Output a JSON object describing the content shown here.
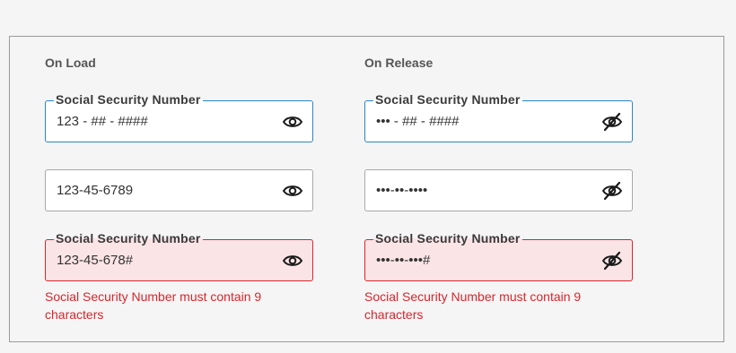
{
  "on_load": {
    "title": "On Load",
    "focused_field": {
      "label": "Social Security Number",
      "value": "123 - ## - ####",
      "icon": "eye-icon"
    },
    "filled_field": {
      "value": "123-45-6789",
      "icon": "eye-icon"
    },
    "error_field": {
      "label": "Social Security Number",
      "value": "123-45-678#",
      "icon": "eye-icon"
    },
    "error_message": "Social Security Number must contain 9 characters"
  },
  "on_release": {
    "title": "On Release",
    "focused_field": {
      "label": "Social Security Number",
      "value": "••• - ## - ####",
      "icon": "eye-slash-icon"
    },
    "filled_field": {
      "value": "•••-••-••••",
      "icon": "eye-slash-icon"
    },
    "error_field": {
      "label": "Social Security Number",
      "value": "•••-••-•••#",
      "icon": "eye-slash-icon"
    },
    "error_message": "Social Security Number must contain 9 characters"
  },
  "colors": {
    "focus_border": "#2a86c7",
    "error_border": "#d8262d",
    "error_background": "#fbe4e6",
    "error_text": "#d8262d"
  }
}
